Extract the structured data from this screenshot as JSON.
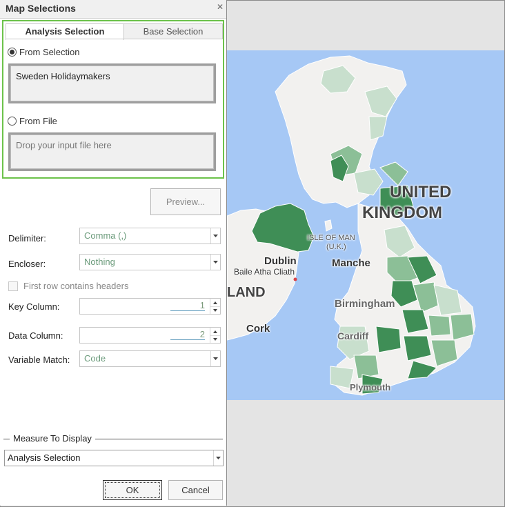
{
  "panel": {
    "title": "Map Selections",
    "close_icon": "close-icon"
  },
  "tabs": [
    {
      "label": "Analysis Selection",
      "active": true
    },
    {
      "label": "Base Selection",
      "active": false
    }
  ],
  "source": {
    "from_selection_label": "From Selection",
    "from_selection_checked": true,
    "selection_value": "Sweden Holidaymakers",
    "from_file_label": "From File",
    "from_file_checked": false,
    "file_placeholder": "Drop your input file here"
  },
  "preview_button": "Preview...",
  "form": {
    "delimiter_label": "Delimiter:",
    "delimiter_value": "Comma (,)",
    "encloser_label": "Encloser:",
    "encloser_value": "Nothing",
    "headers_label": "First row contains headers",
    "headers_checked": false,
    "key_column_label": "Key Column:",
    "key_column_value": "1",
    "data_column_label": "Data Column:",
    "data_column_value": "2",
    "variable_match_label": "Variable Match:",
    "variable_match_value": "Code"
  },
  "measure": {
    "section_label": "Measure To Display",
    "value": "Analysis Selection"
  },
  "buttons": {
    "ok": "OK",
    "cancel": "Cancel"
  },
  "map": {
    "labels": {
      "country": "UNITED KINGDOM",
      "country_line1": "UNITED",
      "country_line2": "KINGDOM",
      "dublin": "Dublin",
      "baile": "Baile Atha Cliath",
      "ireland_partial": "LAND",
      "isle_of_man": "ISLE OF MAN",
      "isle_of_man_sub": "(U.K.)",
      "manchester": "Manche",
      "birmingham": "Birmingham",
      "cork": "Cork",
      "cardiff": "Cardiff",
      "plymouth": "Plymouth"
    },
    "colors": {
      "sea": "#a6c8f5",
      "land": "#f2f1ef",
      "shade_light": "#c8dfcd",
      "shade_mid": "#8cbf97",
      "shade_dark": "#3f8e56"
    }
  }
}
